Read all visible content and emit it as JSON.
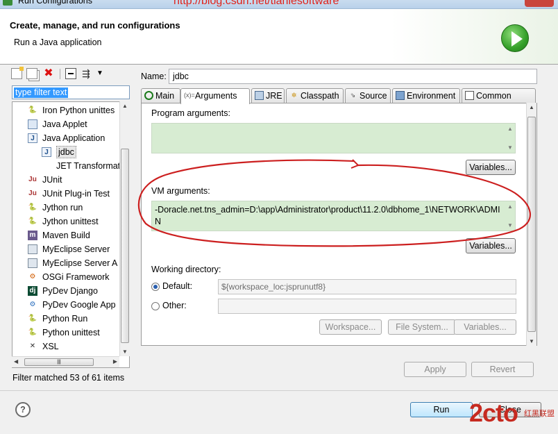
{
  "window": {
    "title": "Run Configurations",
    "watermark_url": "http://blog.csdn.net/tianlesoftware"
  },
  "banner": {
    "title": "Create, manage, and run configurations",
    "subtitle": "Run a Java application"
  },
  "left": {
    "filter_placeholder": "type filter text",
    "tree": [
      {
        "label": "Iron Python unittes",
        "icon": "python-icon",
        "level": 1
      },
      {
        "label": "Java Applet",
        "icon": "applet-icon",
        "level": 1
      },
      {
        "label": "Java Application",
        "icon": "java-app-icon",
        "level": 1
      },
      {
        "label": "jdbc",
        "icon": "java-app-icon",
        "level": 2,
        "selected": true
      },
      {
        "label": "JET Transformation",
        "icon": "",
        "level": 2
      },
      {
        "label": "JUnit",
        "icon": "junit-icon",
        "level": 1
      },
      {
        "label": "JUnit Plug-in Test",
        "icon": "junit-icon",
        "level": 1
      },
      {
        "label": "Jython run",
        "icon": "jython-icon",
        "level": 1
      },
      {
        "label": "Jython unittest",
        "icon": "jython-icon",
        "level": 1
      },
      {
        "label": "Maven Build",
        "icon": "maven-icon",
        "level": 1
      },
      {
        "label": "MyEclipse Server",
        "icon": "server-icon",
        "level": 1
      },
      {
        "label": "MyEclipse Server A",
        "icon": "server-icon",
        "level": 1
      },
      {
        "label": "OSGi Framework",
        "icon": "osgi-icon",
        "level": 1
      },
      {
        "label": "PyDev Django",
        "icon": "django-icon",
        "level": 1
      },
      {
        "label": "PyDev Google App",
        "icon": "google-app-icon",
        "level": 1
      },
      {
        "label": "Python Run",
        "icon": "python-icon",
        "level": 1
      },
      {
        "label": "Python unittest",
        "icon": "python-icon",
        "level": 1
      },
      {
        "label": "XSL",
        "icon": "xsl-icon",
        "level": 1
      }
    ],
    "status": "Filter matched 53 of 61 items"
  },
  "right": {
    "name_label": "Name:",
    "name_value": "jdbc",
    "tabs": [
      {
        "label": "Main",
        "icon": "main-icon"
      },
      {
        "label": "Arguments",
        "icon": "arguments-icon",
        "active": true
      },
      {
        "label": "JRE",
        "icon": "jre-icon"
      },
      {
        "label": "Classpath",
        "icon": "classpath-icon"
      },
      {
        "label": "Source",
        "icon": "source-icon"
      },
      {
        "label": "Environment",
        "icon": "environment-icon"
      },
      {
        "label": "Common",
        "icon": "common-icon"
      }
    ],
    "program_args_label": "Program arguments:",
    "program_args_value": "",
    "vm_args_label": "VM arguments:",
    "vm_args_value": "-Doracle.net.tns_admin=D:\\app\\Administrator\\product\\11.2.0\\dbhome_1\\NETWORK\\ADMIN",
    "variables_label": "Variables...",
    "working_dir_label": "Working directory:",
    "default_label": "Default:",
    "default_value": "${workspace_loc:jsprunutf8}",
    "other_label": "Other:",
    "other_value": "",
    "workspace_btn": "Workspace...",
    "filesystem_btn": "File System...",
    "variables_btn2": "Variables..."
  },
  "footer": {
    "apply_label": "Apply",
    "revert_label": "Revert",
    "run_label": "Run",
    "close_label": "Close",
    "watermark_logo": "2cto",
    "watermark_text": "红黑联盟"
  },
  "colors": {
    "annotation": "#cc1f1f",
    "args_bg": "#d7ecd2",
    "run_green": "#35a02a"
  }
}
